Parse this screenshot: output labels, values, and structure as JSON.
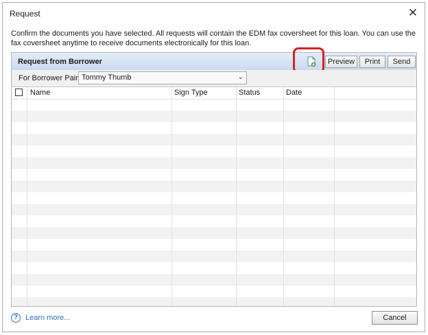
{
  "window": {
    "title": "Request",
    "close_glyph": "✕"
  },
  "description": "Confirm the documents you have selected. All requests will contain the EDM fax coversheet for this loan. You can use the fax coversheet anytime to receive documents electronically for this loan.",
  "panel": {
    "title": "Request from Borrower",
    "toolbar": {
      "add_document_icon": "add-document-icon",
      "preview_label": "Preview",
      "print_label": "Print",
      "send_label": "Send"
    },
    "filter": {
      "label": "For Borrower Pair",
      "selected": "Tommy Thumb"
    },
    "columns": [
      "Name",
      "Sign Type",
      "Status",
      "Date"
    ],
    "rows": []
  },
  "footer": {
    "help_glyph": "?",
    "learn_more": "Learn more...",
    "cancel_label": "Cancel"
  },
  "colors": {
    "highlight": "#d81f1f",
    "link": "#2f6fb6",
    "header_gradient_top": "#e4edf8",
    "header_gradient_bottom": "#c9daef"
  }
}
